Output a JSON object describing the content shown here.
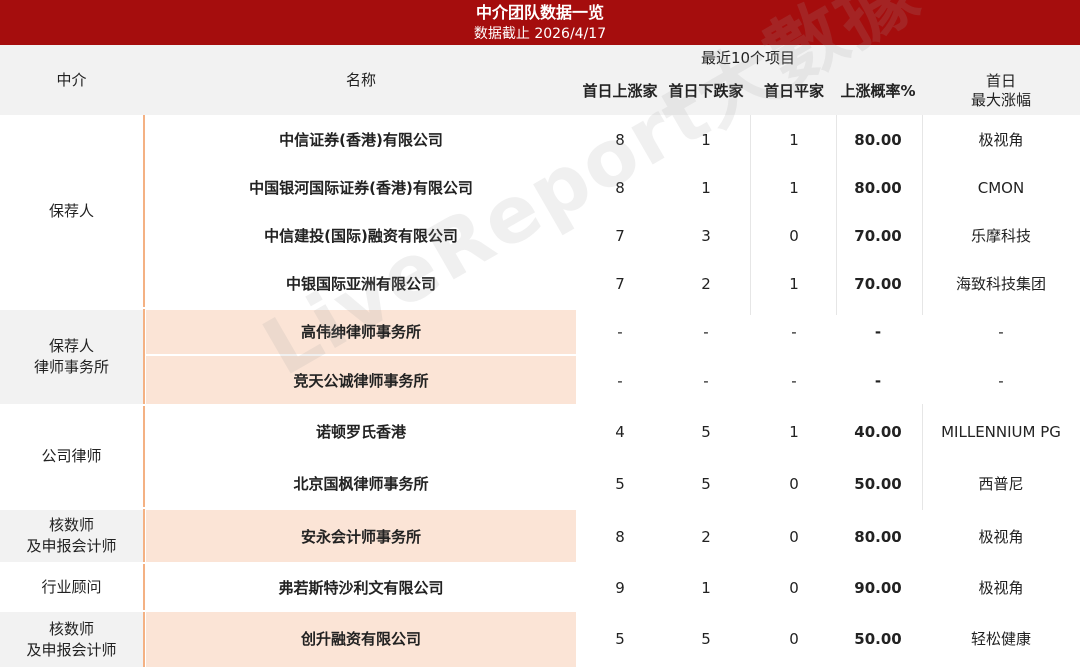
{
  "title": "中介团队数据一览",
  "subtitle": "数据截止 2026/4/17",
  "watermark": "LiveReport大數據",
  "header": {
    "col_agency": "中介",
    "col_name": "名称",
    "group_label": "最近10个项目",
    "col_up": "首日上涨家",
    "col_down": "首日下跌家",
    "col_flat": "首日平家",
    "col_rate": "上涨概率%",
    "col_max_line1": "首日",
    "col_max_line2": "最大涨幅"
  },
  "groups": [
    {
      "label": "保荐人"
    },
    {
      "label_line1": "保荐人",
      "label_line2": "律师事务所"
    },
    {
      "label": "公司律师"
    },
    {
      "label_line1": "核数师",
      "label_line2": "及申报会计师"
    },
    {
      "label": "行业顾问"
    },
    {
      "label_line1": "核数师",
      "label_line2": "及申报会计师"
    }
  ],
  "rows": [
    {
      "name": "中信证券(香港)有限公司",
      "up": "8",
      "down": "1",
      "flat": "1",
      "rate": "80.00",
      "max": "极视角"
    },
    {
      "name": "中国银河国际证券(香港)有限公司",
      "up": "8",
      "down": "1",
      "flat": "1",
      "rate": "80.00",
      "max": "CMON"
    },
    {
      "name": "中信建投(国际)融资有限公司",
      "up": "7",
      "down": "3",
      "flat": "0",
      "rate": "70.00",
      "max": "乐摩科技"
    },
    {
      "name": "中银国际亚洲有限公司",
      "up": "7",
      "down": "2",
      "flat": "1",
      "rate": "70.00",
      "max": "海致科技集团"
    },
    {
      "name": "高伟绅律师事务所",
      "up": "-",
      "down": "-",
      "flat": "-",
      "rate": "-",
      "max": "-"
    },
    {
      "name": "竞天公诚律师事务所",
      "up": "-",
      "down": "-",
      "flat": "-",
      "rate": "-",
      "max": "-"
    },
    {
      "name": "诺顿罗氏香港",
      "up": "4",
      "down": "5",
      "flat": "1",
      "rate": "40.00",
      "max": "MILLENNIUM PG"
    },
    {
      "name": "北京国枫律师事务所",
      "up": "5",
      "down": "5",
      "flat": "0",
      "rate": "50.00",
      "max": "西普尼"
    },
    {
      "name": "安永会计师事务所",
      "up": "8",
      "down": "2",
      "flat": "0",
      "rate": "80.00",
      "max": "极视角"
    },
    {
      "name": "弗若斯特沙利文有限公司",
      "up": "9",
      "down": "1",
      "flat": "0",
      "rate": "90.00",
      "max": "极视角"
    },
    {
      "name": "创升融资有限公司",
      "up": "5",
      "down": "5",
      "flat": "0",
      "rate": "50.00",
      "max": "轻松健康"
    }
  ]
}
